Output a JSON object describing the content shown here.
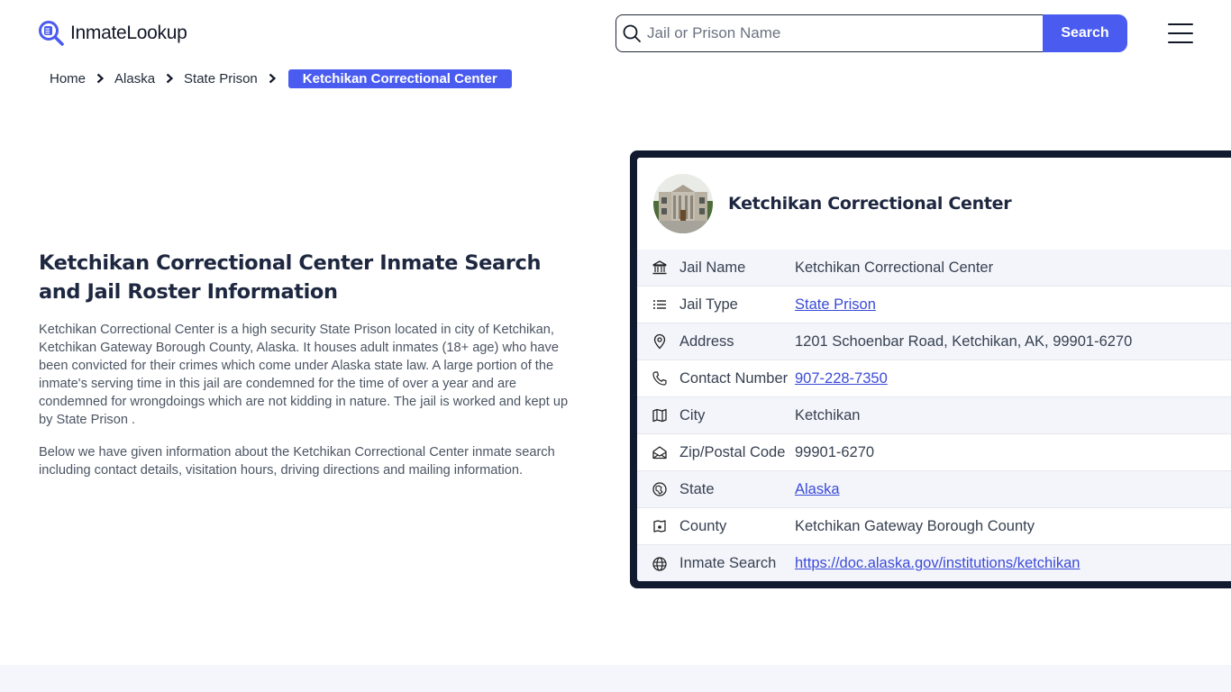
{
  "header": {
    "logo_text": "InmateLookup",
    "logo_icon": "magnifier-document-icon",
    "search_placeholder": "Jail or Prison Name",
    "search_value": "",
    "search_button_label": "Search",
    "menu_icon": "hamburger-menu-icon"
  },
  "breadcrumb": {
    "items": [
      "Home",
      "Alaska",
      "State Prison"
    ],
    "current": "Ketchikan Correctional Center",
    "separator_icon": "chevron-right-icon"
  },
  "intro": {
    "title": "Ketchikan Correctional Center Inmate Search and Jail Roster Information",
    "paragraphs": [
      "Ketchikan Correctional Center is a high security State Prison located in city of Ketchikan, Ketchikan Gateway Borough County, Alaska. It houses adult inmates (18+ age) who have been convicted for their crimes which come under Alaska state law. A large portion of the inmate's serving time in this jail are condemned for the time of over a year and are condemned for wrongdoings which are not kidding in nature. The jail is worked and kept up by State Prison .",
      "Below we have given information about the Ketchikan Correctional Center inmate search including contact details, visitation hours, driving directions and mailing information."
    ]
  },
  "card": {
    "title": "Ketchikan Correctional Center",
    "avatar": "facility-building-photo",
    "rows": [
      {
        "icon": "building-columns-icon",
        "label": "Jail Name",
        "value": "Ketchikan Correctional Center",
        "link": false
      },
      {
        "icon": "list-icon",
        "label": "Jail Type",
        "value": "State Prison",
        "link": true
      },
      {
        "icon": "map-pin-icon",
        "label": "Address",
        "value": "1201 Schoenbar Road, Ketchikan, AK, 99901-6270",
        "link": false
      },
      {
        "icon": "phone-icon",
        "label": "Contact Number",
        "value": "907-228-7350",
        "link": true
      },
      {
        "icon": "map-icon",
        "label": "City",
        "value": "Ketchikan",
        "link": false
      },
      {
        "icon": "mail-open-icon",
        "label": "Zip/Postal Code",
        "value": "99901-6270",
        "link": false
      },
      {
        "icon": "globe-region-icon",
        "label": "State",
        "value": "Alaska",
        "link": true
      },
      {
        "icon": "map-marker-square-icon",
        "label": "County",
        "value": "Ketchikan Gateway Borough County",
        "link": false
      },
      {
        "icon": "globe-icon",
        "label": "Inmate Search",
        "value": "https://doc.alaska.gov/institutions/ketchikan",
        "link": true
      }
    ]
  },
  "colors": {
    "accent": "#4a5cf0",
    "card_border": "#111a2e",
    "heading": "#1e2740",
    "link": "#3b4bd8",
    "row_stripe": "#f4f5fb"
  }
}
